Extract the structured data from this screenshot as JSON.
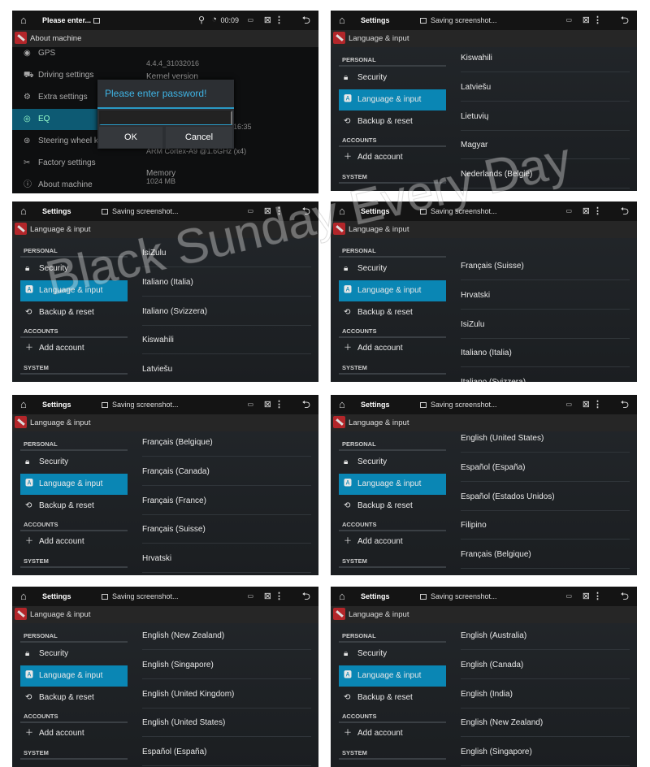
{
  "watermark": "Black Sunday Every Day",
  "accent": "#0a86b4",
  "panel1": {
    "status": {
      "title": "Please enter...",
      "time": "00:09"
    },
    "title_bar": "About machine",
    "menu": [
      {
        "label": "GPS",
        "icon": "gps-icon"
      },
      {
        "label": "Driving settings",
        "icon": "car-icon"
      },
      {
        "label": "Extra settings",
        "icon": "gears-icon"
      },
      {
        "label": "EQ",
        "icon": "eq-icon",
        "selected": true
      },
      {
        "label": "Steering wheel k",
        "icon": "steering-wheel-icon"
      },
      {
        "label": "Factory settings",
        "icon": "tools-icon"
      },
      {
        "label": "About machine",
        "icon": "info-icon"
      }
    ],
    "details": [
      "4.4.4_31032016",
      "Kernel version",
      "16:35",
      "ARM Cortex-A9 @1.6GHz (x4)",
      "Memory",
      "1024 MB"
    ],
    "dialog": {
      "title": "Please enter password!",
      "value": "",
      "ok": "OK",
      "cancel": "Cancel"
    }
  },
  "settings": {
    "status_title": "Settings",
    "notification": "Saving screenshot...",
    "title_bar": "Language & input",
    "headers": {
      "personal": "PERSONAL",
      "accounts": "ACCOUNTS",
      "system": "SYSTEM"
    },
    "menu": {
      "security": "Security",
      "language": "Language & input",
      "backup": "Backup & reset",
      "add_account": "Add account"
    }
  },
  "lists": [
    [
      "Kiswahili",
      "Latviešu",
      "Lietuvių",
      "Magyar",
      "Nederlands (België)"
    ],
    [
      "IsiZulu",
      "Italiano (Italia)",
      "Italiano (Svizzera)",
      "Kiswahili",
      "Latviešu"
    ],
    [
      "Français (Suisse)",
      "Hrvatski",
      "IsiZulu",
      "Italiano (Italia)",
      "Italiano (Svizzera)"
    ],
    [
      "Français (Belgique)",
      "Français (Canada)",
      "Français (France)",
      "Français (Suisse)",
      "Hrvatski"
    ],
    [
      "English (United States)",
      "Español (España)",
      "Español (Estados Unidos)",
      "Filipino",
      "Français (Belgique)"
    ],
    [
      "English (New Zealand)",
      "English (Singapore)",
      "English (United Kingdom)",
      "English (United States)",
      "Español (España)"
    ],
    [
      "English (Australia)",
      "English (Canada)",
      "English (India)",
      "English (New Zealand)",
      "English (Singapore)"
    ]
  ]
}
